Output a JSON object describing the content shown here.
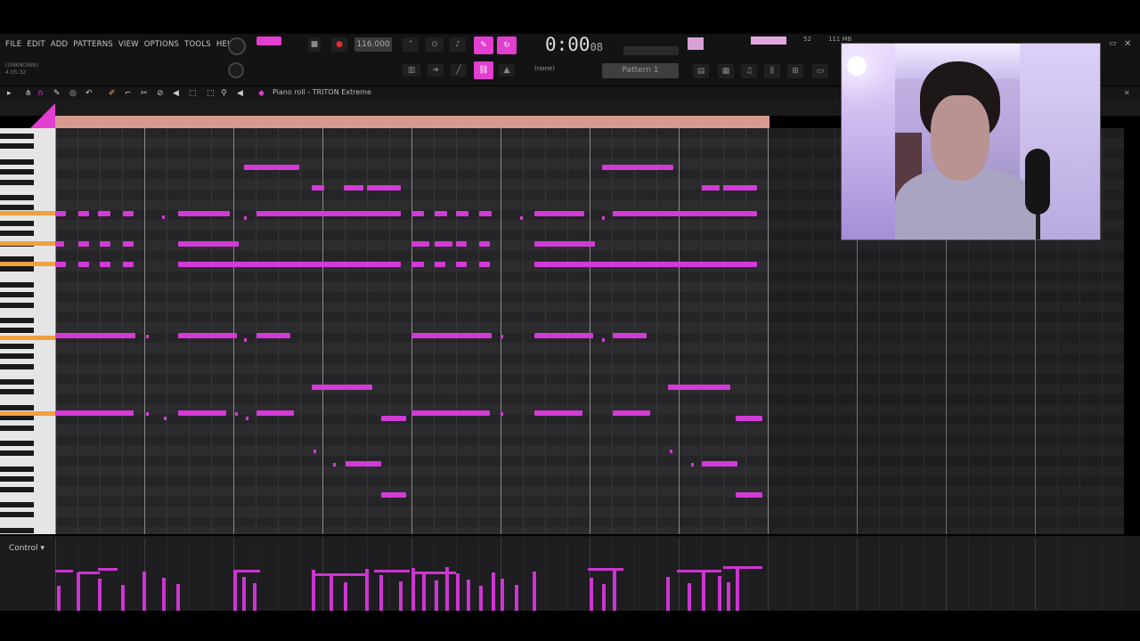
{
  "menu": [
    "FILE",
    "EDIT",
    "ADD",
    "PATTERNS",
    "VIEW",
    "OPTIONS",
    "TOOLS",
    "HELP"
  ],
  "hint": [
    "(UNKNOWN)",
    "4:05:32"
  ],
  "tempo": "116.000",
  "time": "0:00",
  "time_frac": "08",
  "pattern": "Pattern 1",
  "preset": "(none)",
  "cpu": "52",
  "mem": "111 MB",
  "piano_roll_title": "Piano roll - TRITON Extreme",
  "control_label": "Control",
  "accent_color": "#d23bd8",
  "icons": [
    "magnet-icon",
    "pencil-icon",
    "paint-icon",
    "delete-icon",
    "mute-icon",
    "slice-icon",
    "select-icon",
    "zoom-icon",
    "play-icon"
  ]
}
